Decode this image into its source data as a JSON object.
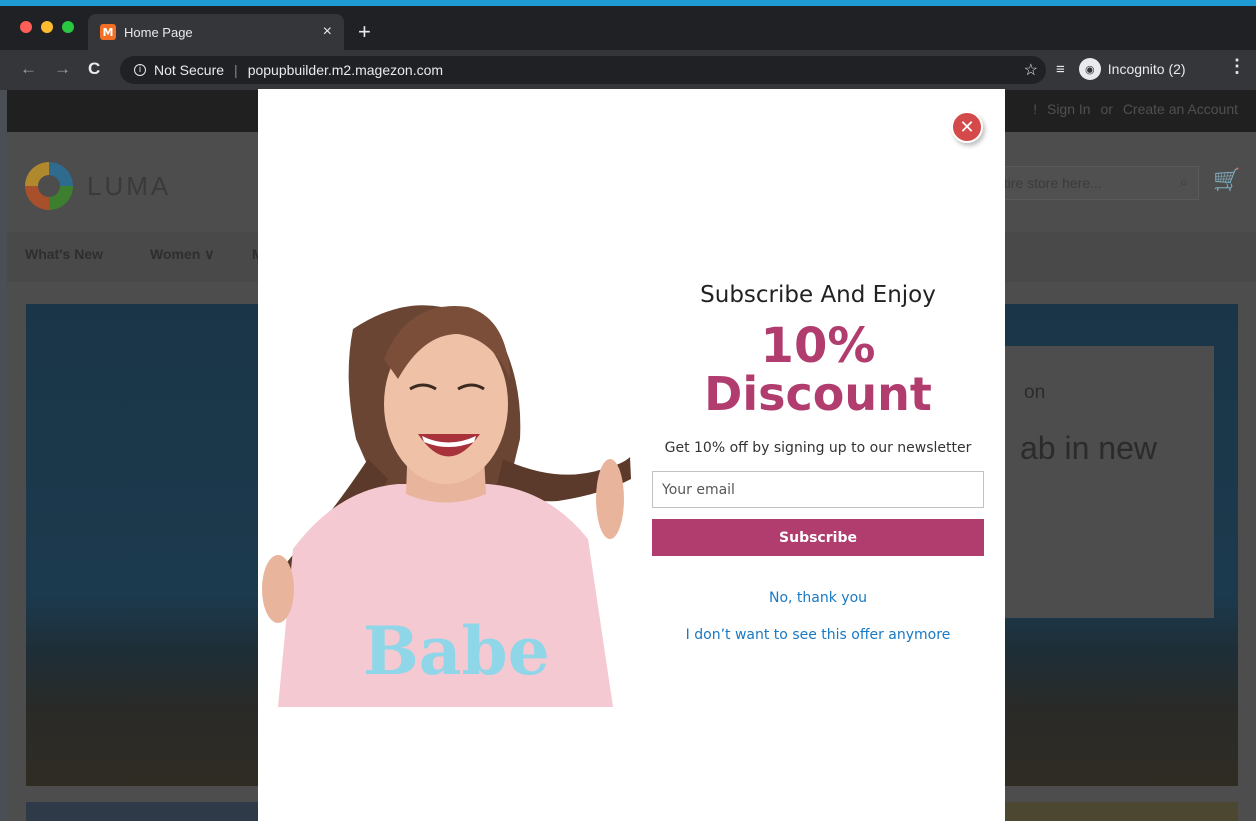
{
  "browser": {
    "tab_title": "Home Page",
    "tab_favicon": "M",
    "tab_close": "×",
    "new_tab": "+",
    "back": "←",
    "forward": "→",
    "reload": "C",
    "security_label": "Not Secure",
    "security_icon": "i",
    "url": "popupbuilder.m2.magezon.com",
    "bookmark_icon": "☆",
    "media_icon": "≡",
    "incognito_icon": "◉",
    "incognito_label": "Incognito (2)",
    "menu_icon": "⋮",
    "accent_color": "#1f9bd6"
  },
  "store": {
    "top_links": [
      "!",
      "Sign In",
      "or",
      "Create an Account"
    ],
    "logo_text": "LUMA",
    "search_placeholder": "ntire store here...",
    "search_icon": "⌕",
    "cart_icon": "🛒",
    "nav": [
      "What's New",
      "Women ∨",
      "M"
    ],
    "hero_line1": "on",
    "hero_line2": "ab in new"
  },
  "popup": {
    "close_icon": "✕",
    "heading": "Subscribe And Enjoy",
    "percent": "10%",
    "discount": "Discount",
    "description": "Get 10% off by signing up to our newsletter",
    "email_placeholder": "Your email",
    "subscribe_label": "Subscribe",
    "decline_label": "No, thank you",
    "never_label": "I don’t want to see this offer anymore",
    "shirt_text": "Babe",
    "brand_color": "#b13c6e",
    "link_color": "#1979c3"
  }
}
